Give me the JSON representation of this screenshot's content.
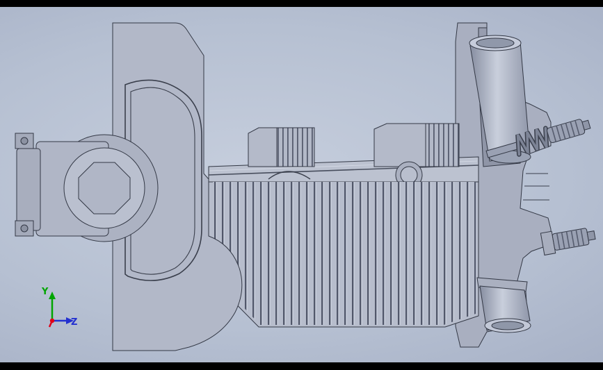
{
  "scene": {
    "model_name": "single-cylinder-engine-section",
    "background_center": "#c6cedd",
    "background_edge": "#96a0b7",
    "model_fill": "#b6bccb",
    "model_fill_dark": "#a9afc0",
    "model_outline": "#333845",
    "fin_line_color": "#51576a",
    "letterbox_color": "#000000"
  },
  "triad": {
    "y_label": "Y",
    "z_label": "Z",
    "y_color": "#00a500",
    "z_color": "#2330d0",
    "x_color": "#e00018"
  }
}
